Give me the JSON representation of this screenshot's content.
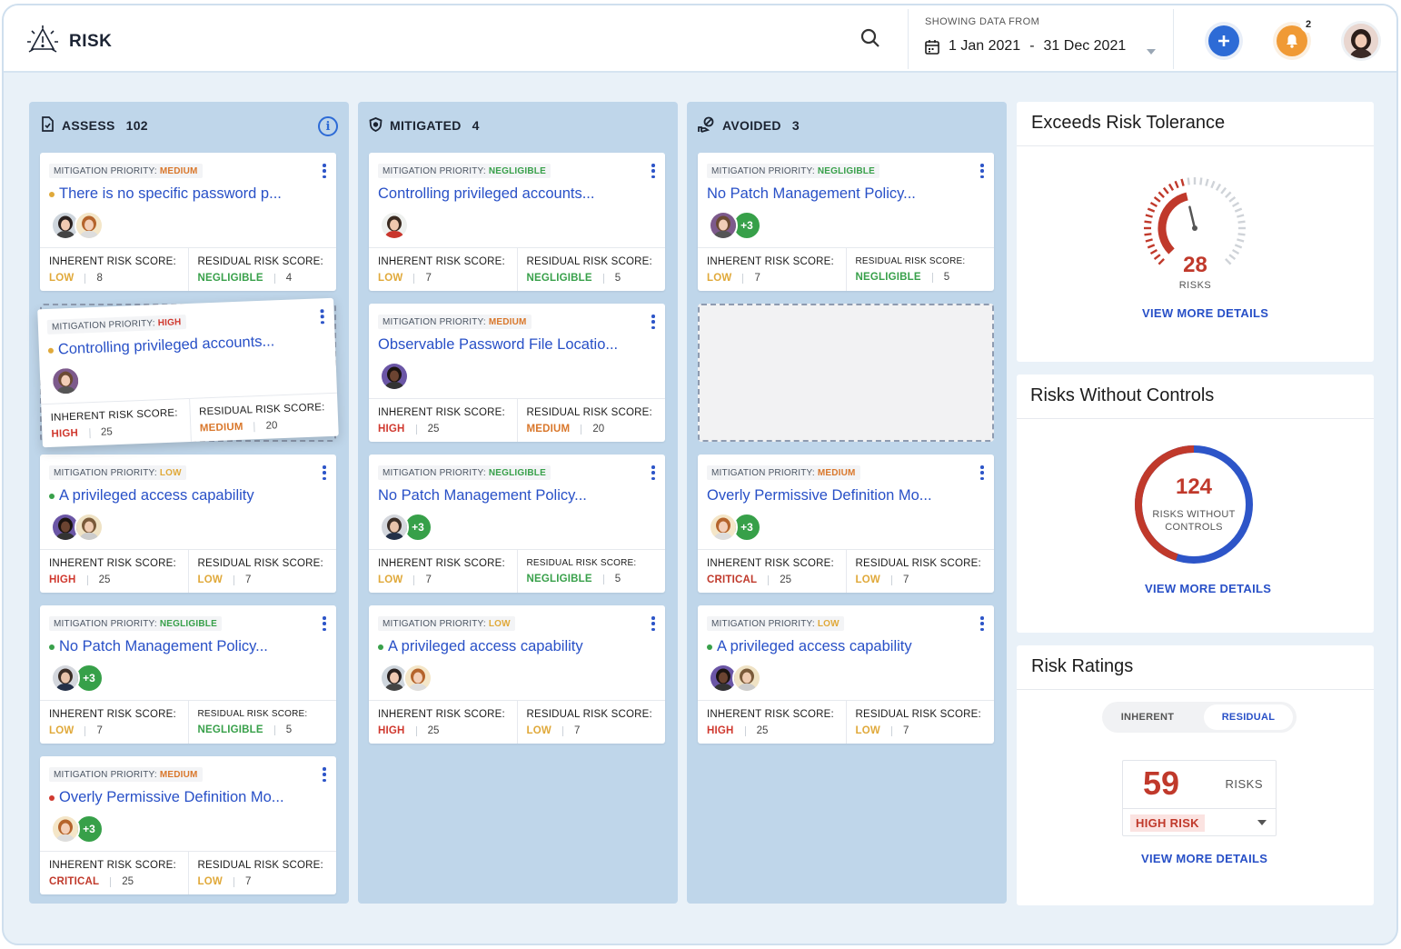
{
  "app": {
    "title": "RISK"
  },
  "header": {
    "date_caption": "SHOWING DATA FROM",
    "date_from": "1 Jan 2021",
    "date_sep": "-",
    "date_to": "31 Dec 2021",
    "notification_count": "2"
  },
  "labels": {
    "priority_prefix": "MITIGATION PRIORITY:",
    "inherent": "INHERENT RISK SCORE:",
    "residual": "RESIDUAL RISK SCORE:"
  },
  "colors": {
    "accent": "#2d6bd6",
    "low": "#e0a93a",
    "negligible": "#38a04a",
    "medium": "#d9772b",
    "high": "#d0392f",
    "critical": "#c0392b"
  },
  "columns": [
    {
      "name": "ASSESS",
      "count": "102",
      "icon": "document-check-icon",
      "cards": [
        {
          "priority": "MEDIUM",
          "title": "There is no specific password p...",
          "dot": "low",
          "avatars": [
            "woman-dark-hair",
            "woman-red-hair"
          ],
          "more": "",
          "inherent_level": "LOW",
          "inherent_value": "8",
          "residual_level": "NEGLIGIBLE",
          "residual_value": "4",
          "residual_small": false
        },
        {
          "priority": "HIGH",
          "title": "Controlling privileged accounts...",
          "dot": "low",
          "avatars": [
            "woman-brown-hair"
          ],
          "more": "",
          "inherent_level": "HIGH",
          "inherent_value": "25",
          "residual_level": "MEDIUM",
          "residual_value": "20",
          "residual_small": false,
          "dragging": true
        },
        {
          "priority": "LOW",
          "title": "A privileged access capability",
          "dot": "negligible",
          "avatars": [
            "man-dark",
            "man-light"
          ],
          "more": "",
          "inherent_level": "HIGH",
          "inherent_value": "25",
          "residual_level": "LOW",
          "residual_value": "7",
          "residual_small": false
        },
        {
          "priority": "NEGLIGIBLE",
          "title": "No Patch Management Policy...",
          "dot": "negligible",
          "avatars": [
            "man-suit"
          ],
          "more": "+3",
          "inherent_level": "LOW",
          "inherent_value": "7",
          "residual_level": "NEGLIGIBLE",
          "residual_value": "5",
          "residual_small": true
        },
        {
          "priority": "MEDIUM",
          "title": "Overly Permissive Definition Mo...",
          "dot": "high",
          "avatars": [
            "woman-red-hair"
          ],
          "more": "+3",
          "inherent_level": "CRITICAL",
          "inherent_value": "25",
          "residual_level": "LOW",
          "residual_value": "7",
          "residual_small": false
        }
      ]
    },
    {
      "name": "MITIGATED",
      "count": "4",
      "icon": "shield-icon",
      "cards": [
        {
          "priority": "NEGLIGIBLE",
          "title": "Controlling privileged accounts...",
          "dot": "",
          "avatars": [
            "man-smiling"
          ],
          "more": "",
          "inherent_level": "LOW",
          "inherent_value": "7",
          "residual_level": "NEGLIGIBLE",
          "residual_value": "5",
          "residual_small": false
        },
        {
          "priority": "MEDIUM",
          "title": "Observable Password File Locatio...",
          "dot": "",
          "avatars": [
            "man-dark"
          ],
          "more": "",
          "inherent_level": "HIGH",
          "inherent_value": "25",
          "residual_level": "MEDIUM",
          "residual_value": "20",
          "residual_small": false
        },
        {
          "priority": "NEGLIGIBLE",
          "title": "No Patch Management Policy...",
          "dot": "",
          "avatars": [
            "man-suit"
          ],
          "more": "+3",
          "inherent_level": "LOW",
          "inherent_value": "7",
          "residual_level": "NEGLIGIBLE",
          "residual_value": "5",
          "residual_small": true
        },
        {
          "priority": "LOW",
          "title": "A privileged access capability",
          "dot": "negligible",
          "avatars": [
            "woman-dark-hair",
            "woman-red-hair"
          ],
          "more": "",
          "inherent_level": "HIGH",
          "inherent_value": "25",
          "residual_level": "LOW",
          "residual_value": "7",
          "residual_small": false
        }
      ]
    },
    {
      "name": "AVOIDED",
      "count": "3",
      "icon": "avoid-icon",
      "cards": [
        {
          "priority": "NEGLIGIBLE",
          "title": "No Patch Management Policy...",
          "dot": "",
          "avatars": [
            "woman-brown-hair"
          ],
          "more": "+3",
          "inherent_level": "LOW",
          "inherent_value": "7",
          "residual_level": "NEGLIGIBLE",
          "residual_value": "5",
          "residual_small": true
        },
        {
          "placeholder": true
        },
        {
          "priority": "MEDIUM",
          "title": "Overly Permissive Definition Mo...",
          "dot": "",
          "avatars": [
            "woman-red-hair"
          ],
          "more": "+3",
          "inherent_level": "CRITICAL",
          "inherent_value": "25",
          "residual_level": "LOW",
          "residual_value": "7",
          "residual_small": false
        },
        {
          "priority": "LOW",
          "title": "A privileged access capability",
          "dot": "negligible",
          "avatars": [
            "man-dark",
            "man-light"
          ],
          "more": "",
          "inherent_level": "HIGH",
          "inherent_value": "25",
          "residual_level": "LOW",
          "residual_value": "7",
          "residual_small": false
        }
      ]
    }
  ],
  "panels": {
    "tolerance": {
      "title": "Exceeds Risk Tolerance",
      "value": "28",
      "unit": "RISKS",
      "link": "VIEW MORE DETAILS",
      "gauge_fraction": 0.45
    },
    "controls": {
      "title": "Risks Without Controls",
      "value": "124",
      "unit_line1": "RISKS WITHOUT",
      "unit_line2": "CONTROLS",
      "link": "VIEW MORE DETAILS",
      "red_fraction": 0.45
    },
    "ratings": {
      "title": "Risk Ratings",
      "tab_inherent": "INHERENT",
      "tab_residual": "RESIDUAL",
      "active_tab": "RESIDUAL",
      "value": "59",
      "unit": "RISKS",
      "selected": "HIGH RISK",
      "link": "VIEW MORE DETAILS"
    }
  }
}
